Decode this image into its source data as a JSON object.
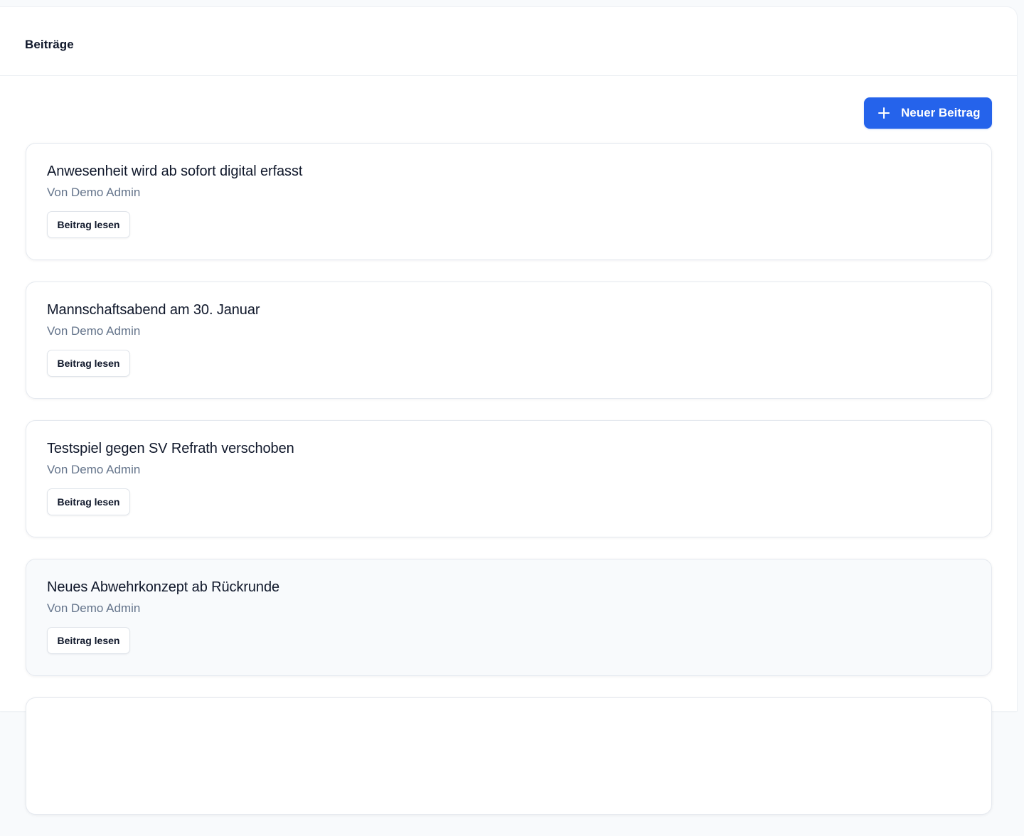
{
  "header": {
    "title": "Beiträge"
  },
  "toolbar": {
    "new_post_label": "Neuer Beitrag",
    "new_post_icon": "plus-icon"
  },
  "colors": {
    "accent": "#2563eb",
    "muted_text": "#64748b"
  },
  "posts": [
    {
      "title": "Anwesenheit wird ab sofort digital erfasst",
      "author": "Von Demo Admin",
      "read_label": "Beitrag lesen"
    },
    {
      "title": "Mannschaftsabend am 30. Januar",
      "author": "Von Demo Admin",
      "read_label": "Beitrag lesen"
    },
    {
      "title": "Testspiel gegen SV Refrath verschoben",
      "author": "Von Demo Admin",
      "read_label": "Beitrag lesen"
    },
    {
      "title": "Neues Abwehrkonzept ab Rückrunde",
      "author": "Von Demo Admin",
      "read_label": "Beitrag lesen"
    }
  ]
}
